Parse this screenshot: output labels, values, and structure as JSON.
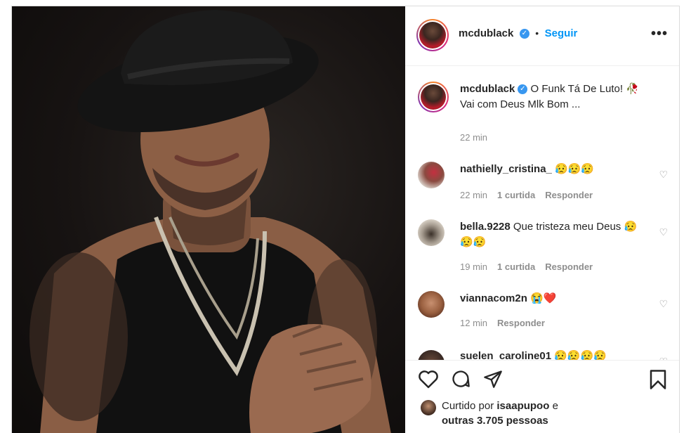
{
  "post": {
    "author": {
      "username": "mcdublack",
      "verified_icon": "verified-badge-icon",
      "separator": "•",
      "follow_label": "Seguir",
      "more_icon": "more-options-icon",
      "more_label": "•••"
    },
    "caption": {
      "username": "mcdublack",
      "text": "O Funk Tá De Luto! 🥀 Vai com Deus Mlk Bom ...",
      "time": "22 min"
    },
    "comments": [
      {
        "username": "nathielly_cristina_",
        "text": "😥😥😥",
        "time": "22 min",
        "likes": "1 curtida",
        "reply": "Responder"
      },
      {
        "username": "bella.9228",
        "text": "Que tristeza meu Deus 😥😥😥",
        "time": "19 min",
        "likes": "1 curtida",
        "reply": "Responder"
      },
      {
        "username": "viannacom2n",
        "text": "😭❤️",
        "time": "12 min",
        "likes": "",
        "reply": "Responder"
      },
      {
        "username": "suelen_caroline01",
        "text": "😥😥😥😥",
        "time": "",
        "likes": "",
        "reply": ""
      }
    ],
    "actions": {
      "like_icon": "heart-icon",
      "comment_icon": "comment-icon",
      "share_icon": "share-icon",
      "save_icon": "bookmark-icon"
    },
    "liked_by": {
      "prefix": "Curtido por",
      "user": "isaapupoo",
      "connector": "e",
      "others": "outras 3.705 pessoas"
    }
  },
  "colors": {
    "accent": "#0095f6",
    "verified": "#3897f0",
    "muted": "#8e8e8e",
    "text": "#262626"
  }
}
